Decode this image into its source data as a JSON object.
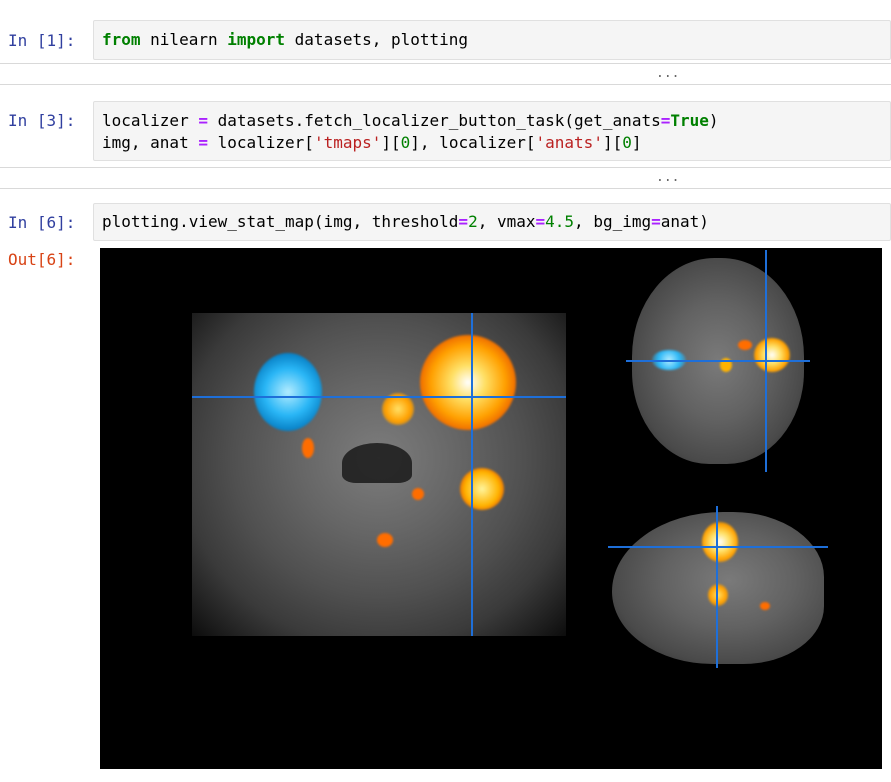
{
  "cells": [
    {
      "prompt": "In [1]:",
      "code_lines": [
        [
          {
            "cls": "kw",
            "text": "from"
          },
          {
            "cls": "",
            "text": " nilearn "
          },
          {
            "cls": "kw",
            "text": "import"
          },
          {
            "cls": "",
            "text": " datasets, plotting"
          }
        ]
      ],
      "collapsed_output": "..."
    },
    {
      "prompt": "In [3]:",
      "code_lines": [
        [
          {
            "cls": "",
            "text": "localizer "
          },
          {
            "cls": "op",
            "text": "="
          },
          {
            "cls": "",
            "text": " datasets.fetch_localizer_button_task(get_anats"
          },
          {
            "cls": "op",
            "text": "="
          },
          {
            "cls": "kw",
            "text": "True"
          },
          {
            "cls": "",
            "text": ")"
          }
        ],
        [
          {
            "cls": "",
            "text": "img, anat "
          },
          {
            "cls": "op",
            "text": "="
          },
          {
            "cls": "",
            "text": " localizer["
          },
          {
            "cls": "str",
            "text": "'tmaps'"
          },
          {
            "cls": "",
            "text": "]["
          },
          {
            "cls": "num",
            "text": "0"
          },
          {
            "cls": "",
            "text": "], localizer["
          },
          {
            "cls": "str",
            "text": "'anats'"
          },
          {
            "cls": "",
            "text": "]["
          },
          {
            "cls": "num",
            "text": "0"
          },
          {
            "cls": "",
            "text": "]"
          }
        ]
      ],
      "collapsed_output": "..."
    },
    {
      "prompt": "In [6]:",
      "code_lines": [
        [
          {
            "cls": "",
            "text": "plotting.view_stat_map(img, threshold"
          },
          {
            "cls": "op",
            "text": "="
          },
          {
            "cls": "num",
            "text": "2"
          },
          {
            "cls": "",
            "text": ", vmax"
          },
          {
            "cls": "op",
            "text": "="
          },
          {
            "cls": "num",
            "text": "4.5"
          },
          {
            "cls": "",
            "text": ", bg_img"
          },
          {
            "cls": "op",
            "text": "="
          },
          {
            "cls": "",
            "text": "anat)"
          }
        ]
      ],
      "out_prompt": "Out[6]:"
    }
  ],
  "colors": {
    "in_prompt": "#303f9f",
    "out_prompt": "#d84315",
    "keyword": "#008000",
    "operator": "#aa22ff",
    "string": "#ba2121",
    "crosshair": "#1e6fd9",
    "activation_positive": "#ff8c00",
    "activation_negative": "#29b6f6"
  },
  "icons": {
    "coronal_view": "brain-coronal-slice",
    "axial_view": "brain-axial-slice",
    "sagittal_view": "brain-sagittal-slice"
  }
}
